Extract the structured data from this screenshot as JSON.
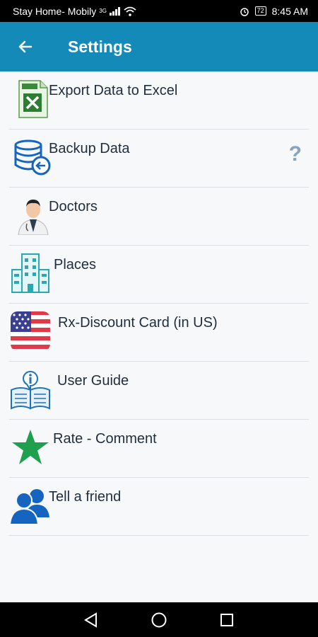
{
  "status_bar": {
    "carrier": "Stay Home- Mobily",
    "network": "3G",
    "battery": "72",
    "time": "8:45 AM"
  },
  "app_bar": {
    "title": "Settings"
  },
  "menu": {
    "items": [
      {
        "label": "Export Data to Excel",
        "icon": "excel-icon"
      },
      {
        "label": "Backup Data",
        "icon": "database-backup-icon",
        "help": "?"
      },
      {
        "label": "Doctors",
        "icon": "doctor-icon"
      },
      {
        "label": "Places",
        "icon": "building-icon"
      },
      {
        "label": "Rx-Discount Card (in US)",
        "icon": "us-flag-icon"
      },
      {
        "label": "User Guide",
        "icon": "user-guide-book-icon"
      },
      {
        "label": "Rate - Comment",
        "icon": "star-icon"
      },
      {
        "label": "Tell a friend",
        "icon": "people-icon"
      }
    ]
  },
  "colors": {
    "app_bar": "#148ab9",
    "background": "#f7f8f9",
    "text": "#1f2d3d",
    "divider": "#dcdfe1",
    "star": "#1ea04f",
    "people": "#1565c0"
  }
}
